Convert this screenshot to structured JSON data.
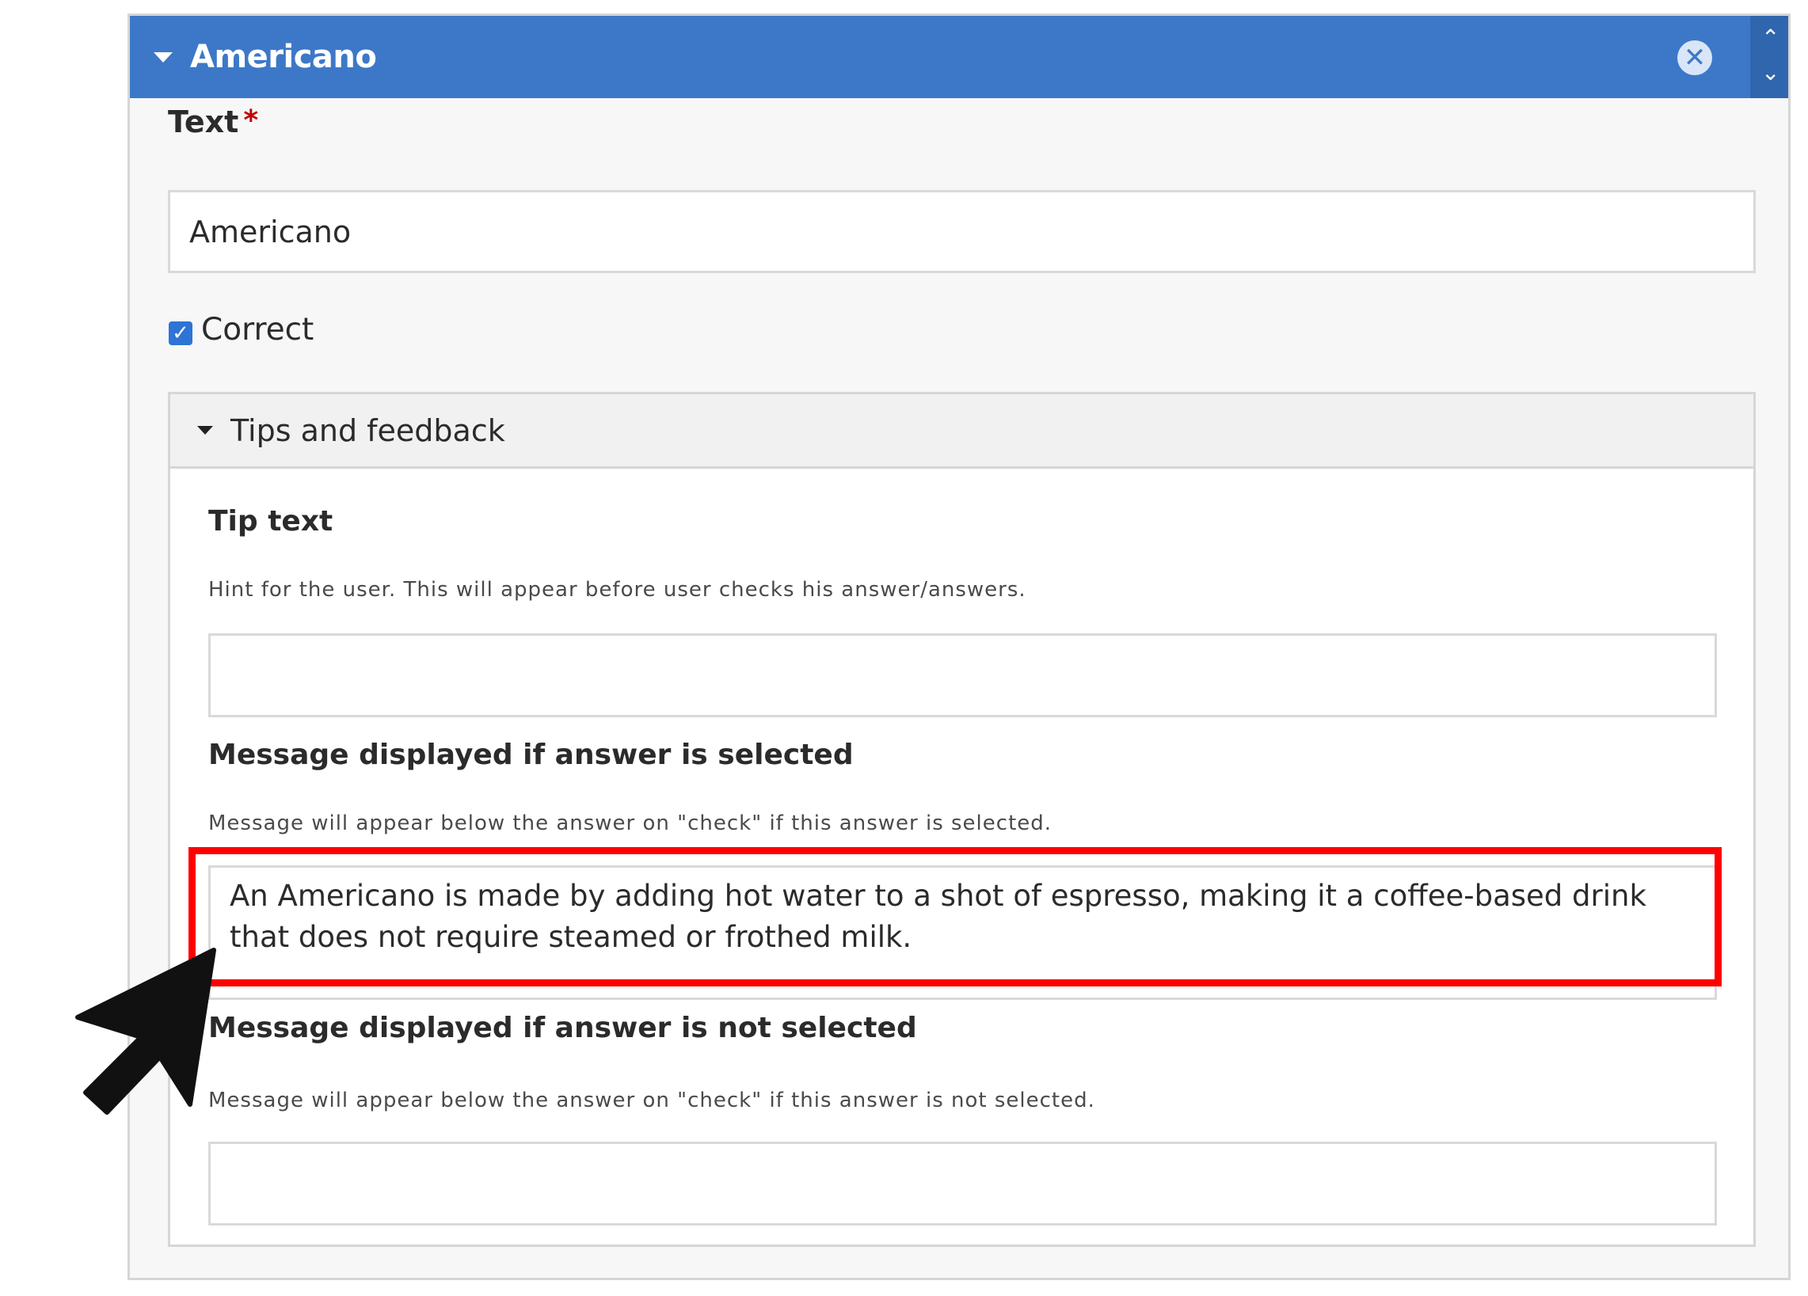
{
  "item": {
    "title": "Americano"
  },
  "fields": {
    "text_label": "Text",
    "required_mark": "*",
    "text_value": "Americano",
    "correct_label": "Correct",
    "correct_checked": true
  },
  "tips": {
    "legend": "Tips and feedback",
    "tip_label": "Tip text",
    "tip_desc": "Hint for the user. This will appear before user checks his answer/answers.",
    "tip_value": "",
    "selected_label": "Message displayed if answer is selected",
    "selected_desc": "Message will appear below the answer on \"check\" if this answer is selected.",
    "selected_value": "An Americano is made by adding hot water to a shot of espresso, making it a coffee-based drink that does not require steamed or frothed milk.",
    "not_selected_label": "Message displayed if answer is not selected",
    "not_selected_desc": "Message will appear below the answer on \"check\" if this answer is not selected.",
    "not_selected_value": ""
  },
  "icons": {
    "collapse": "caret-down-icon",
    "remove": "close-circle-icon",
    "move_up": "chevron-up-icon",
    "move_down": "chevron-down-icon",
    "checkbox": "checkbox-checked-icon",
    "pointer": "arrow-pointer-icon"
  },
  "colors": {
    "header": "#3d78c8",
    "highlight": "#ff0000",
    "required": "#c00000"
  }
}
